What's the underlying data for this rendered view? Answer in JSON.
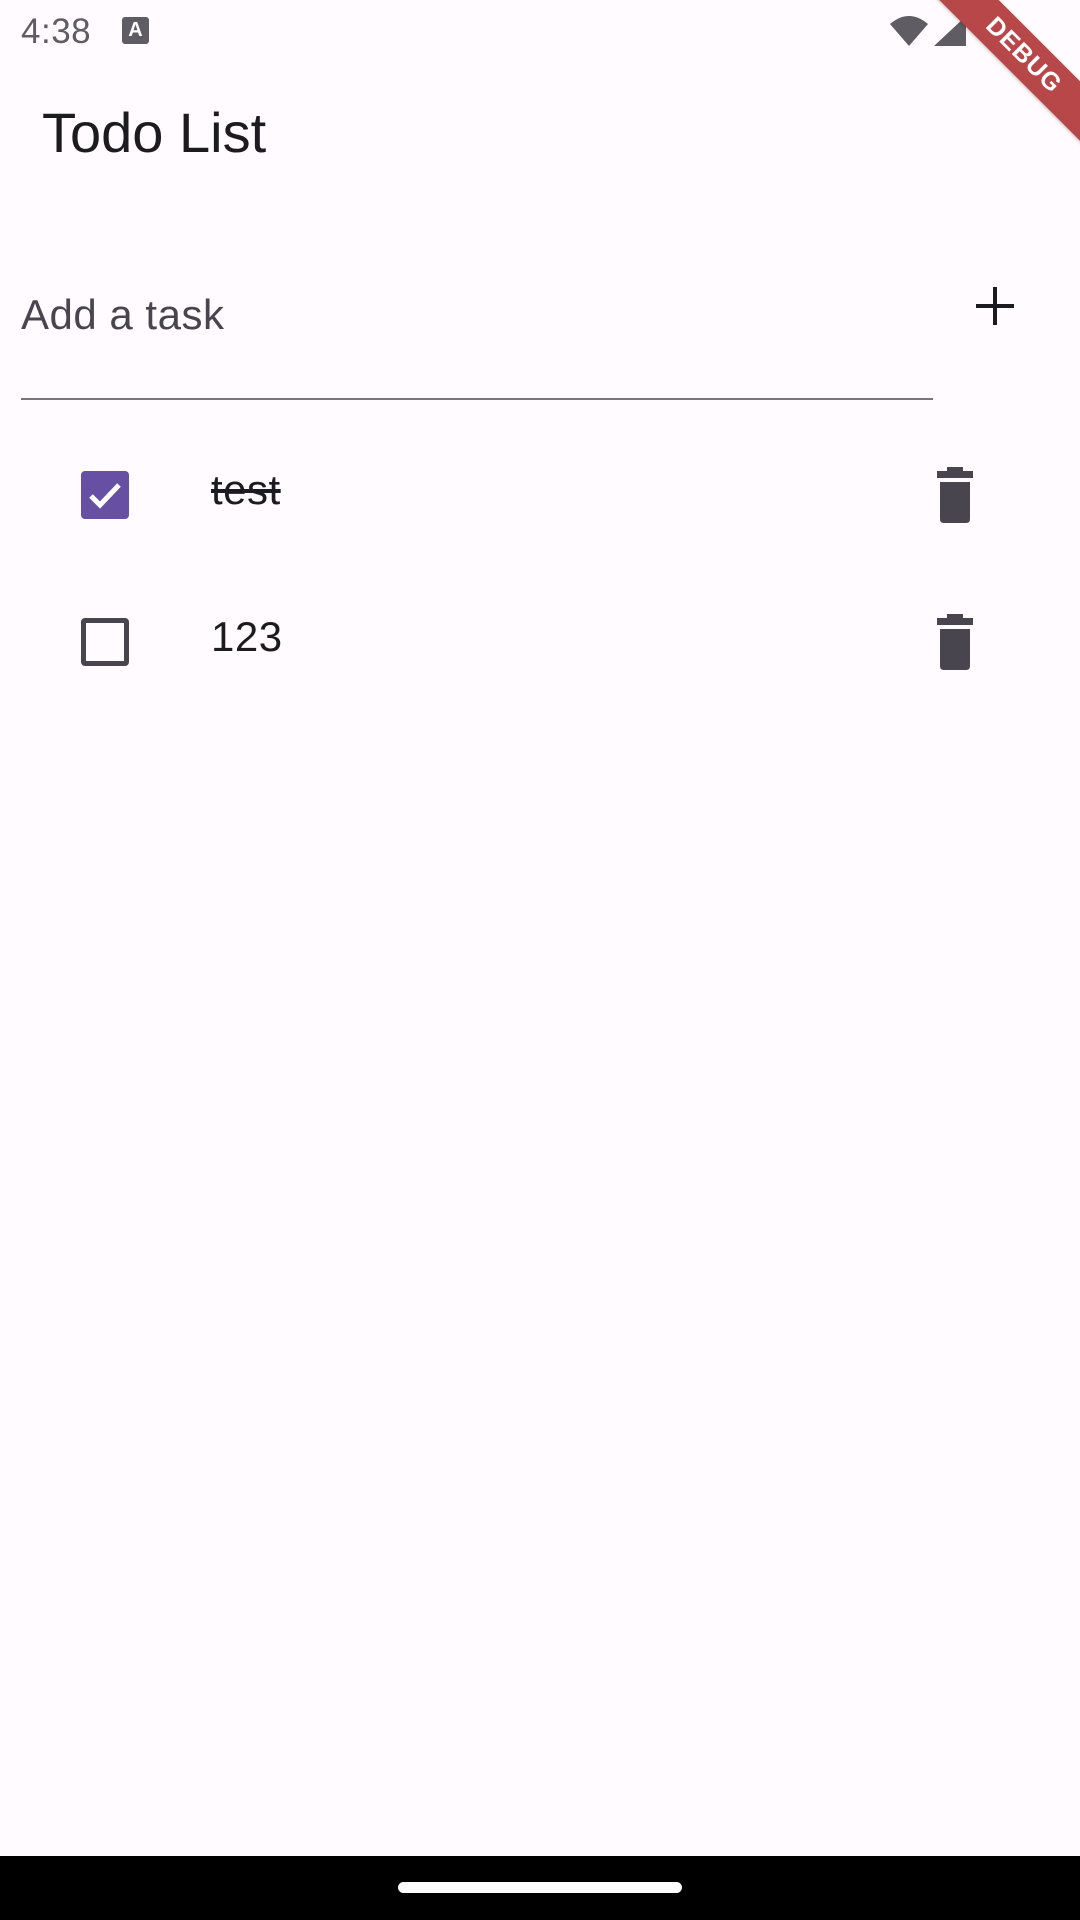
{
  "status_bar": {
    "time": "4:38",
    "notification_icon": "text-a-icon",
    "notification_glyph": "A",
    "icons": [
      "wifi-icon",
      "signal-icon",
      "battery-icon"
    ]
  },
  "debug_banner": {
    "label": "DEBUG"
  },
  "app_bar": {
    "title": "Todo List"
  },
  "input": {
    "placeholder": "Add a task",
    "value": "",
    "add_icon": "plus-icon"
  },
  "tasks": [
    {
      "text": "test",
      "completed": true,
      "delete_icon": "trash-icon"
    },
    {
      "text": "123",
      "completed": false,
      "delete_icon": "trash-icon"
    }
  ],
  "colors": {
    "background": "#fffbfe",
    "primary": "#6750a4",
    "on_surface": "#1c1b1f",
    "icon": "#49454f",
    "debug_banner": "#b8474a"
  }
}
